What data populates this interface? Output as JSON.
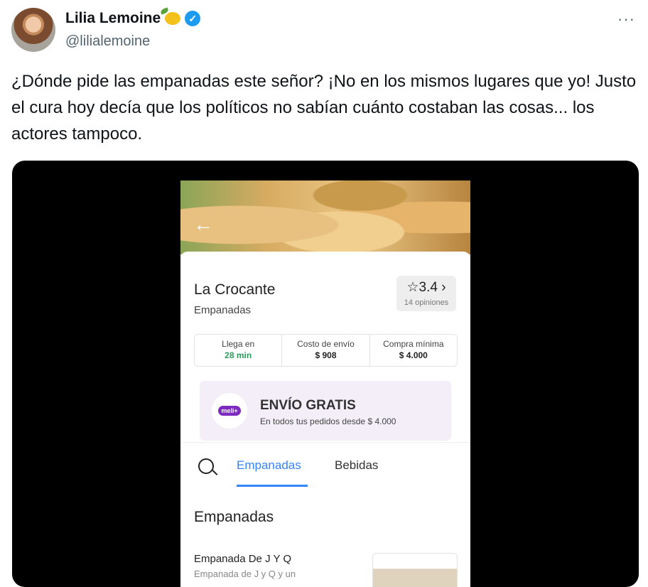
{
  "author": {
    "name": "Lilia Lemoine",
    "handle": "@lilialemoine",
    "more_icon": "···"
  },
  "tweet": {
    "text": "¿Dónde pide las empanadas este señor? ¡No en los mismos lugares que yo! Justo el cura hoy decía que los políticos no sabían cuánto costaban las cosas... los actores tampoco."
  },
  "app": {
    "back_icon": "←",
    "restaurant": "La Crocante",
    "category": "Empanadas",
    "rating": "☆3.4 ›",
    "reviews": "14 opiniones",
    "info": [
      {
        "label": "Llega en",
        "value": "28 min"
      },
      {
        "label": "Costo de envío",
        "value": "$ 908"
      },
      {
        "label": "Compra mínima",
        "value": "$ 4.000"
      }
    ],
    "promo": {
      "badge": "meli+",
      "title": "ENVÍO GRATIS",
      "subtitle": "En todos tus pedidos desde $ 4.000"
    },
    "tabs": [
      "Empanadas",
      "Bebidas"
    ],
    "section_title": "Empanadas",
    "item": {
      "name": "Empanada De J Y Q",
      "desc": "Empanada de J y Q y un"
    }
  }
}
